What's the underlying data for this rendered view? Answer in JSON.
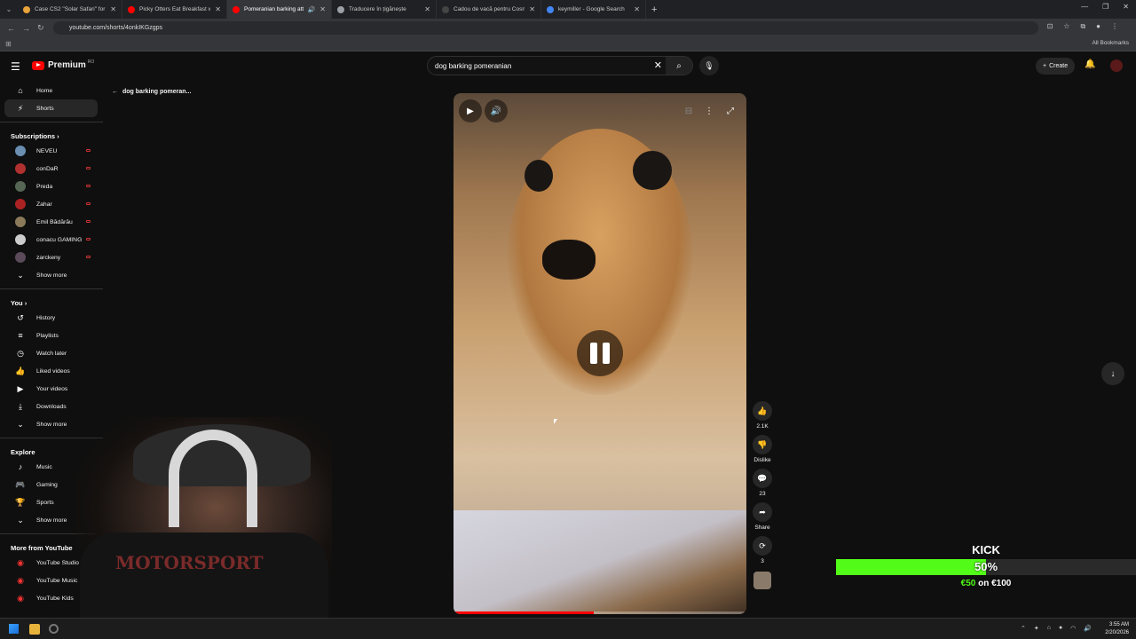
{
  "browser": {
    "tabs": [
      {
        "title": "Case CS2 \"Solar Safari\" for 6.99",
        "color": "#e8a33b"
      },
      {
        "title": "Picky Otters Eat Breakfast with",
        "color": "#ff0000"
      },
      {
        "title": "Pomeranian barking attack",
        "color": "#ff0000",
        "active": true
      },
      {
        "title": "Traducere în țigănește",
        "color": "#9aa0a6"
      },
      {
        "title": "Cadou de vacă pentru Cosmin",
        "color": "#444444"
      },
      {
        "title": "keymiller - Google Search",
        "color": "#4285f4"
      }
    ],
    "url": "youtube.com/shorts/4onkIKGzgps",
    "all_bookmarks": "All Bookmarks"
  },
  "youtube": {
    "logo_text": "Premium",
    "logo_sup": "RO",
    "search_value": "dog barking pomeranian",
    "create_label": "Create",
    "back_label": "dog barking pomeran...",
    "sidebar": {
      "main": [
        {
          "label": "Home",
          "icon": "home-icon",
          "glyph": "⌂"
        },
        {
          "label": "Shorts",
          "icon": "shorts-icon",
          "glyph": "⚡",
          "active": true
        }
      ],
      "subscriptions_title": "Subscriptions",
      "subscriptions": [
        {
          "label": "NEVEU",
          "color": "#6a8fb0"
        },
        {
          "label": "conDaR",
          "color": "#b03030"
        },
        {
          "label": "Preda",
          "color": "#556655"
        },
        {
          "label": "Zahar",
          "color": "#aa2222"
        },
        {
          "label": "Emil Bădărău",
          "color": "#8a7a5a"
        },
        {
          "label": "conacu GAMING",
          "color": "#cccccc"
        },
        {
          "label": "zarckeny",
          "color": "#5a4a5a"
        }
      ],
      "show_more": "Show more",
      "you_title": "You",
      "you": [
        {
          "label": "History",
          "icon": "history-icon",
          "glyph": "↺"
        },
        {
          "label": "Playlists",
          "icon": "playlists-icon",
          "glyph": "≡"
        },
        {
          "label": "Watch later",
          "icon": "watch-later-icon",
          "glyph": "◷"
        },
        {
          "label": "Liked videos",
          "icon": "like-icon",
          "glyph": "👍"
        },
        {
          "label": "Your videos",
          "icon": "your-videos-icon",
          "glyph": "▶"
        },
        {
          "label": "Downloads",
          "icon": "download-icon",
          "glyph": "⤓"
        }
      ],
      "explore_title": "Explore",
      "explore": [
        {
          "label": "Music",
          "icon": "music-icon",
          "glyph": "♪"
        },
        {
          "label": "Gaming",
          "icon": "gaming-icon",
          "glyph": "🎮"
        },
        {
          "label": "Sports",
          "icon": "sports-icon",
          "glyph": "🏆"
        }
      ],
      "more_title": "More from YouTube",
      "more": [
        {
          "label": "YouTube Studio"
        },
        {
          "label": "YouTube Music"
        },
        {
          "label": "YouTube Kids"
        }
      ]
    },
    "actions": {
      "likes": "2.1K",
      "dislike": "Dislike",
      "comments": "23",
      "share": "Share",
      "remix": "3"
    },
    "progress": 0.48
  },
  "overlay": {
    "shirt_text": "MOTORSPORT",
    "donation": {
      "title": "KICK",
      "percent_label": "50%",
      "progress": 0.5,
      "raised": "€50",
      "sep": "on",
      "goal": "€100"
    }
  },
  "taskbar": {
    "time": "3:55 AM",
    "date": "2/20/2026"
  }
}
